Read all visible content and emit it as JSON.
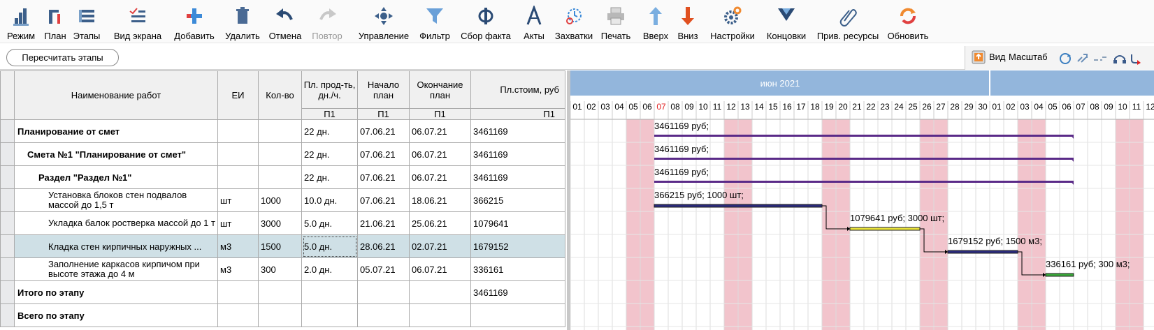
{
  "toolbar": [
    {
      "name": "mode",
      "label": "Режим",
      "icon": "mode-icon"
    },
    {
      "name": "plan",
      "label": "План",
      "icon": "plan-icon"
    },
    {
      "name": "stages",
      "label": "Этапы",
      "icon": "stages-icon"
    },
    {
      "name": "screen-view",
      "label": "Вид экрана",
      "icon": "screen-view-icon"
    },
    {
      "name": "add",
      "label": "Добавить",
      "icon": "plus-icon"
    },
    {
      "name": "delete",
      "label": "Удалить",
      "icon": "trash-icon"
    },
    {
      "name": "undo",
      "label": "Отмена",
      "icon": "undo-icon"
    },
    {
      "name": "redo",
      "label": "Повтор",
      "icon": "redo-icon",
      "disabled": true
    },
    {
      "name": "control",
      "label": "Управление",
      "icon": "move-icon"
    },
    {
      "name": "filter",
      "label": "Фильтр",
      "icon": "filter-icon"
    },
    {
      "name": "fact",
      "label": "Сбор факта",
      "icon": "phi-icon"
    },
    {
      "name": "acts",
      "label": "Акты",
      "icon": "letter-a-icon"
    },
    {
      "name": "grips",
      "label": "Захватки",
      "icon": "grips-icon"
    },
    {
      "name": "print",
      "label": "Печать",
      "icon": "printer-icon"
    },
    {
      "name": "up",
      "label": "Вверх",
      "icon": "arrow-up-icon"
    },
    {
      "name": "down",
      "label": "Вниз",
      "icon": "arrow-down-icon"
    },
    {
      "name": "settings",
      "label": "Настройки",
      "icon": "gear-icon"
    },
    {
      "name": "endings",
      "label": "Концовки",
      "icon": "endings-icon"
    },
    {
      "name": "resources",
      "label": "Прив. ресурсы",
      "icon": "paperclip-icon"
    },
    {
      "name": "refresh",
      "label": "Обновить",
      "icon": "refresh-icon"
    }
  ],
  "recalc_label": "Пересчитать этапы",
  "right_tools": {
    "view_label": "Вид",
    "scale_label": "Масштаб"
  },
  "columns": {
    "name": "Наименование работ",
    "unit": "ЕИ",
    "qty": "Кол-во",
    "prod": "Пл. прод-ть, дн./ч.",
    "start": "Начало план",
    "end": "Окончание план",
    "cost": "Пл.стоим, руб",
    "sub": "П1"
  },
  "rows": [
    {
      "name": "Планирование от смет",
      "level": 0,
      "bold": true,
      "unit": "",
      "qty": "",
      "prod": "22 дн.",
      "start": "07.06.21",
      "end": "06.07.21",
      "cost": "3461169"
    },
    {
      "name": "Смета №1 \"Планирование от смет\"",
      "level": 1,
      "bold": true,
      "unit": "",
      "qty": "",
      "prod": "22 дн.",
      "start": "07.06.21",
      "end": "06.07.21",
      "cost": "3461169"
    },
    {
      "name": "Раздел \"Раздел №1\"",
      "level": 2,
      "bold": true,
      "unit": "",
      "qty": "",
      "prod": "22 дн.",
      "start": "07.06.21",
      "end": "06.07.21",
      "cost": "3461169"
    },
    {
      "name": "Установка блоков стен подвалов массой до 1,5 т",
      "level": 3,
      "bold": false,
      "unit": "шт",
      "qty": "1000",
      "prod": "10.0 дн.",
      "start": "07.06.21",
      "end": "18.06.21",
      "cost": "366215"
    },
    {
      "name": "Укладка балок ростверка массой до 1 т",
      "level": 3,
      "bold": false,
      "unit": "шт",
      "qty": "3000",
      "prod": "5.0 дн.",
      "start": "21.06.21",
      "end": "25.06.21",
      "cost": "1079641"
    },
    {
      "name": "Кладка стен кирпичных наружных ...",
      "level": 3,
      "bold": false,
      "unit": "м3",
      "qty": "1500",
      "prod": "5.0 дн.",
      "start": "28.06.21",
      "end": "02.07.21",
      "cost": "1679152",
      "selected": true
    },
    {
      "name": "Заполнение каркасов кирпичом при высоте этажа до 4 м",
      "level": 3,
      "bold": false,
      "unit": "м3",
      "qty": "300",
      "prod": "2.0 дн.",
      "start": "05.07.21",
      "end": "06.07.21",
      "cost": "336161"
    },
    {
      "name": "Итого по этапу",
      "level": 0,
      "bold": true,
      "unit": "",
      "qty": "",
      "prod": "",
      "start": "",
      "end": "",
      "cost": "3461169"
    },
    {
      "name": "Всего по этапу",
      "level": 0,
      "bold": true,
      "unit": "",
      "qty": "",
      "prod": "",
      "start": "",
      "end": "",
      "cost": ""
    }
  ],
  "gantt": {
    "month_label": "июн 2021",
    "days": [
      "01",
      "02",
      "03",
      "04",
      "05",
      "06",
      "07",
      "08",
      "09",
      "10",
      "11",
      "12",
      "13",
      "14",
      "15",
      "16",
      "17",
      "18",
      "19",
      "20",
      "21",
      "22",
      "23",
      "24",
      "25",
      "26",
      "27",
      "28",
      "29",
      "30",
      "01",
      "02",
      "03",
      "04",
      "05",
      "06",
      "07",
      "08",
      "09",
      "10",
      "11",
      "12"
    ],
    "today_index": 6,
    "weekend_indices": [
      4,
      5,
      11,
      12,
      18,
      19,
      25,
      26,
      32,
      33,
      39,
      40
    ],
    "bars": [
      {
        "row": 0,
        "start": 6,
        "end": 35,
        "label": "3461169 руб;",
        "kind": "summary"
      },
      {
        "row": 1,
        "start": 6,
        "end": 35,
        "label": "3461169 руб;",
        "kind": "summary"
      },
      {
        "row": 2,
        "start": 6,
        "end": 35,
        "label": "3461169 руб;",
        "kind": "summary"
      },
      {
        "row": 3,
        "start": 6,
        "end": 17,
        "label": "366215 руб; 1000 шт;",
        "kind": "task",
        "fill": "#2a2a7a"
      },
      {
        "row": 4,
        "start": 20,
        "end": 24,
        "label": "1079641 руб; 3000 шт;",
        "kind": "task",
        "fill": "#e8e23a"
      },
      {
        "row": 5,
        "start": 27,
        "end": 31,
        "label": "1679152 руб; 1500 м3;",
        "kind": "task",
        "fill": "#2a2a7a"
      },
      {
        "row": 6,
        "start": 34,
        "end": 35,
        "label": "336161 руб; 300 м3;",
        "kind": "task",
        "fill": "#3aa83a"
      }
    ],
    "colors": {
      "header": "#93b6dc",
      "weekend": "#f2c4cc",
      "summary": "#5a2a88",
      "today": "#e02020"
    }
  }
}
